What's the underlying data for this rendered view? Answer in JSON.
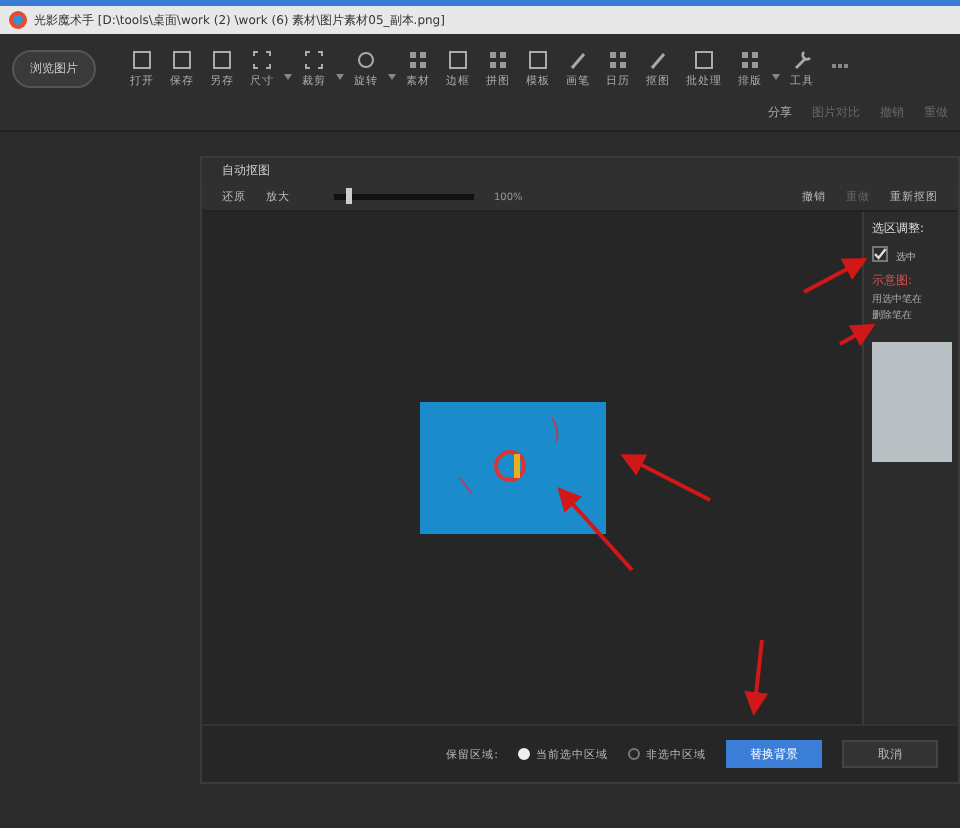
{
  "window": {
    "title": "光影魔术手 [D:\\tools\\桌面\\work (2) \\work (6) 素材\\图片素材05_副本.png]"
  },
  "browse_button": "浏览图片",
  "toolbar": [
    {
      "label": "打开",
      "kind": "open",
      "dropdown": false
    },
    {
      "label": "保存",
      "kind": "save",
      "dropdown": false
    },
    {
      "label": "另存",
      "kind": "saveas",
      "dropdown": false
    },
    {
      "label": "尺寸",
      "kind": "size",
      "dropdown": true
    },
    {
      "label": "裁剪",
      "kind": "crop",
      "dropdown": true
    },
    {
      "label": "旋转",
      "kind": "rotate",
      "dropdown": true
    },
    {
      "label": "素材",
      "kind": "grid",
      "dropdown": false
    },
    {
      "label": "边框",
      "kind": "frame",
      "dropdown": false
    },
    {
      "label": "拼图",
      "kind": "grid",
      "dropdown": false
    },
    {
      "label": "模板",
      "kind": "frame",
      "dropdown": false
    },
    {
      "label": "画笔",
      "kind": "brush",
      "dropdown": false
    },
    {
      "label": "日历",
      "kind": "grid",
      "dropdown": false
    },
    {
      "label": "抠图",
      "kind": "brush",
      "dropdown": false
    },
    {
      "label": "批处理",
      "kind": "frame",
      "dropdown": false
    },
    {
      "label": "排版",
      "kind": "grid",
      "dropdown": true
    },
    {
      "label": "工具",
      "kind": "tool",
      "dropdown": false
    }
  ],
  "sub_toolbar": [
    {
      "label": "分享",
      "disabled": false
    },
    {
      "label": "图片对比",
      "disabled": true
    },
    {
      "label": "撤销",
      "disabled": true
    },
    {
      "label": "重做",
      "disabled": true
    }
  ],
  "dialog": {
    "title": "自动抠图",
    "tools": [
      {
        "label": "还原",
        "disabled": false
      },
      {
        "label": "放大",
        "disabled": false
      }
    ],
    "zoom": {
      "level": 0.1,
      "reading": "100%"
    },
    "actions": [
      {
        "label": "撤销",
        "disabled": false
      },
      {
        "label": "重做",
        "disabled": true
      },
      {
        "label": "重新抠图",
        "disabled": false
      }
    ],
    "side": {
      "heading": "选区调整:",
      "checkbox": {
        "label": "选中",
        "checked": true
      },
      "example_heading": "示意图:",
      "hint": [
        "用选中笔在",
        "删除笔在"
      ]
    },
    "keep_label": "保留区域:",
    "radios": [
      {
        "label": "当前选中区域",
        "selected": true
      },
      {
        "label": "非选中区域",
        "selected": false
      }
    ],
    "buttons": [
      {
        "label": "替换背景",
        "primary": true
      },
      {
        "label": "取消",
        "primary": false
      }
    ]
  }
}
